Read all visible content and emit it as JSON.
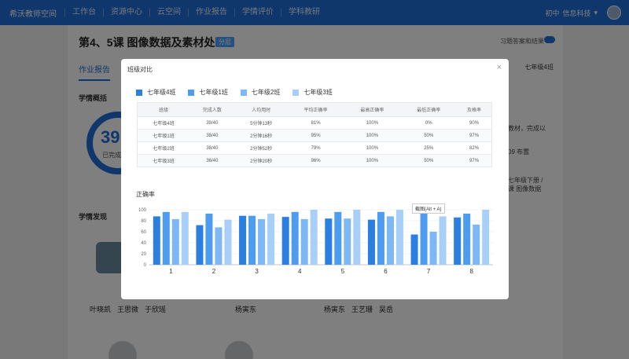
{
  "topnav": {
    "brand": "希沃教师空间",
    "items": [
      "工作台",
      "资源中心",
      "云空间",
      "作业报告",
      "学情评价",
      "学科教研"
    ],
    "grade": "初中",
    "subject": "信息科技"
  },
  "page": {
    "title": "第4、5课 图像数据及素材处理",
    "tag": "分层",
    "toggle_label": "习题答案和结果",
    "tab": "作业报告",
    "right_tab": "七年级4班",
    "section_overview": "学情概括",
    "circle_number": "39",
    "circle_sub": "已完成",
    "section_findings": "学情发现",
    "names_a": [
      "叶晓凯",
      "王思微",
      "于欣瑶"
    ],
    "names_b": [
      "杨寅东"
    ],
    "names_c": [
      "杨寅东",
      "王艺珊",
      "吴岳"
    ],
    "side_lines": [
      "教材，完成以",
      "09 布置",
      "七年级下册 /",
      "课 图像数据"
    ]
  },
  "modal": {
    "title": "班级对比",
    "close": "×",
    "chart_label": "正确率",
    "tooltip": "截图(Alt + A)"
  },
  "chart_data": {
    "type": "bar",
    "categories": [
      "1",
      "2",
      "3",
      "4",
      "5",
      "6",
      "7",
      "8"
    ],
    "series": [
      {
        "name": "七年级4班",
        "color": "#2b7fe0",
        "values": [
          88,
          72,
          89,
          87,
          84,
          82,
          55,
          86
        ]
      },
      {
        "name": "七年级1班",
        "color": "#4d9cf0",
        "values": [
          96,
          93,
          89,
          96,
          96,
          96,
          93,
          93
        ]
      },
      {
        "name": "七年级2班",
        "color": "#7db7f5",
        "values": [
          83,
          68,
          83,
          83,
          84,
          88,
          60,
          73
        ]
      },
      {
        "name": "七年级3班",
        "color": "#a8cff9",
        "values": [
          96,
          82,
          93,
          100,
          100,
          100,
          88,
          100
        ]
      }
    ],
    "ylim": [
      0,
      100
    ],
    "yticks": [
      0,
      20,
      40,
      60,
      80,
      100
    ],
    "xlabel": "",
    "ylabel": "正确率"
  },
  "table": {
    "headers": [
      "班级",
      "完成人数",
      "人均用时",
      "平均正确率",
      "最高正确率",
      "最低正确率",
      "及格率"
    ],
    "rows": [
      [
        "七年级4班",
        "39/40",
        "5分钟13秒",
        "81%",
        "100%",
        "0%",
        "90%"
      ],
      [
        "七年级1班",
        "38/40",
        "2分钟16秒",
        "95%",
        "100%",
        "50%",
        "97%"
      ],
      [
        "七年级2班",
        "38/40",
        "2分钟52秒",
        "79%",
        "100%",
        "25%",
        "82%"
      ],
      [
        "七年级3班",
        "36/40",
        "2分钟20秒",
        "96%",
        "100%",
        "50%",
        "97%"
      ]
    ]
  }
}
